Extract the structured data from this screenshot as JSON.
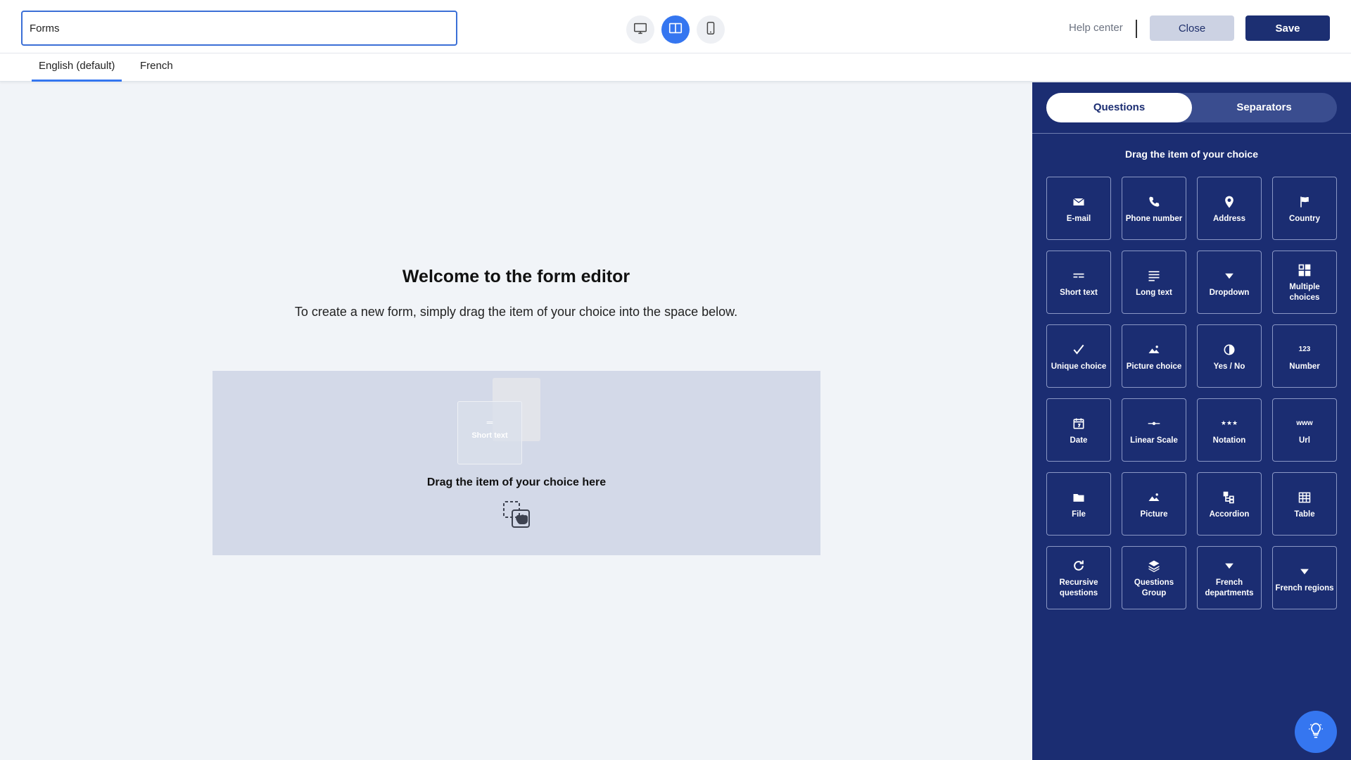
{
  "header": {
    "form_title_value": "Forms",
    "help_center": "Help center",
    "close_label": "Close",
    "save_label": "Save",
    "view_modes": [
      "desktop-icon",
      "split-view-icon",
      "mobile-icon"
    ],
    "active_view_mode": "split-view-icon"
  },
  "languages": {
    "tabs": [
      "English (default)",
      "French"
    ],
    "active": "English (default)"
  },
  "canvas": {
    "title": "Welcome to the form editor",
    "subtitle": "To create a new form, simply drag the item of your choice into the space below.",
    "dropzone_text": "Drag the item of your choice here",
    "ghost_item_label": "Short text"
  },
  "panel": {
    "tabs": [
      "Questions",
      "Separators"
    ],
    "active_tab": "Questions",
    "hint": "Drag the item of your choice",
    "items": [
      {
        "label": "E-mail",
        "icon": "email-icon"
      },
      {
        "label": "Phone number",
        "icon": "phone-icon"
      },
      {
        "label": "Address",
        "icon": "location-pin-icon"
      },
      {
        "label": "Country",
        "icon": "flag-icon"
      },
      {
        "label": "Short text",
        "icon": "short-text-icon"
      },
      {
        "label": "Long text",
        "icon": "long-text-icon"
      },
      {
        "label": "Dropdown",
        "icon": "dropdown-icon"
      },
      {
        "label": "Multiple choices",
        "icon": "multiple-choices-icon"
      },
      {
        "label": "Unique choice",
        "icon": "checkmark-icon"
      },
      {
        "label": "Picture choice",
        "icon": "picture-icon"
      },
      {
        "label": "Yes / No",
        "icon": "half-circle-icon"
      },
      {
        "label": "Number",
        "icon": "number-icon",
        "glyph": "123"
      },
      {
        "label": "Date",
        "icon": "calendar-icon"
      },
      {
        "label": "Linear Scale",
        "icon": "linear-scale-icon"
      },
      {
        "label": "Notation",
        "icon": "stars-icon",
        "glyph": "★★★"
      },
      {
        "label": "Url",
        "icon": "www-icon",
        "glyph": "www"
      },
      {
        "label": "File",
        "icon": "folder-icon"
      },
      {
        "label": "Picture",
        "icon": "picture-icon"
      },
      {
        "label": "Accordion",
        "icon": "accordion-icon"
      },
      {
        "label": "Table",
        "icon": "table-icon"
      },
      {
        "label": "Recursive questions",
        "icon": "refresh-icon"
      },
      {
        "label": "Questions Group",
        "icon": "layers-icon"
      },
      {
        "label": "French departments",
        "icon": "dropdown-icon"
      },
      {
        "label": "French regions",
        "icon": "dropdown-icon"
      }
    ]
  },
  "colors": {
    "panel_bg": "#1b2d72",
    "accent": "#3576f0",
    "save_bg": "#1c2f72",
    "dropzone_bg": "#d3d9e8"
  }
}
